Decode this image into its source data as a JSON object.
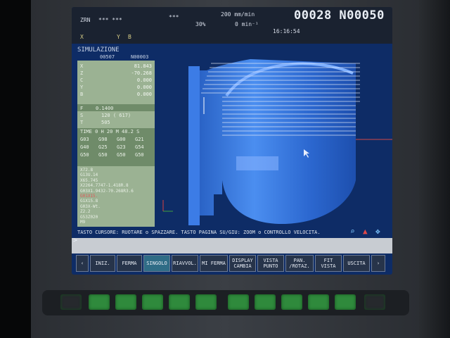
{
  "header": {
    "mode": "ZRN",
    "stars1": "*** ***",
    "stars2": "***",
    "feed": "200 mm/min",
    "override": "30%",
    "spindle": "0 min⁻¹",
    "program": "00028 N00050",
    "time": "16:16:54",
    "axis_icons": [
      "X",
      "Y",
      "B"
    ]
  },
  "simulation": {
    "title": "SIMULAZIONE",
    "prog_a": "00507",
    "prog_b": "N00003",
    "axes": [
      {
        "name": "X",
        "value": "81.843"
      },
      {
        "name": "Z",
        "value": "-70.268"
      },
      {
        "name": "C",
        "value": "0.000"
      },
      {
        "name": "Y",
        "value": "0.000"
      },
      {
        "name": "B",
        "value": "0.000"
      }
    ],
    "feed_label": "F",
    "feed_value": "0.1400",
    "spindle_label": "S",
    "spindle_value": "120 (    617)",
    "tool_label": "T",
    "tool_value": "505",
    "time_row": "TIME  0 H   20 M  48.2 S",
    "gcodes": [
      [
        "G03",
        "G98",
        "G00",
        "G21"
      ],
      [
        "G40",
        "G25",
        "G23",
        "G54"
      ],
      [
        "G50",
        "G50",
        "G50",
        "G50"
      ]
    ],
    "program_lines": [
      "X72.8",
      "G13U.14",
      "X65.745",
      "X2264.7747-1.418R.8",
      "G03X1.9432-70.268R3.6",
      "G01X15.",
      "G1X15.8",
      "G03X-Wt.",
      "Z2.2",
      "G53Z020",
      "M9"
    ]
  },
  "status_text": "TASTO CURSORE: RUOTARE o SPAZZARE. TASTO PAGINA SU/GIU: ZOOM o CONTROLLO VELOCITA.",
  "prompt": ">",
  "softkeys": [
    {
      "label": "‹",
      "active": false
    },
    {
      "label": "INIZ.",
      "active": false
    },
    {
      "label": "FERMA",
      "active": false
    },
    {
      "label": "SINGOLO",
      "active": true
    },
    {
      "label": "RIAVVOL.",
      "active": false
    },
    {
      "label": "MI FERMA",
      "active": false
    },
    {
      "label": "DISPLAY CAMBIA",
      "active": false
    },
    {
      "label": "VISTA PUNTO",
      "active": false
    },
    {
      "label": "PAN. /ROTAZ.",
      "active": false
    },
    {
      "label": "FIT VISTA",
      "active": false
    },
    {
      "label": "USCITA",
      "active": false
    },
    {
      "label": "›",
      "active": false
    }
  ],
  "hardware_buttons": [
    "F0",
    "F1",
    "F2",
    "F3",
    "F4",
    "F5",
    "F6",
    "F7",
    "F8",
    "F9",
    "F10",
    "F11"
  ],
  "view_icons": [
    "zoom-icon",
    "hat-icon",
    "arrows-icon"
  ],
  "colors": {
    "screen": "#0e2c66",
    "part": "#2f6fd6",
    "green_panel": "#9bb293"
  }
}
